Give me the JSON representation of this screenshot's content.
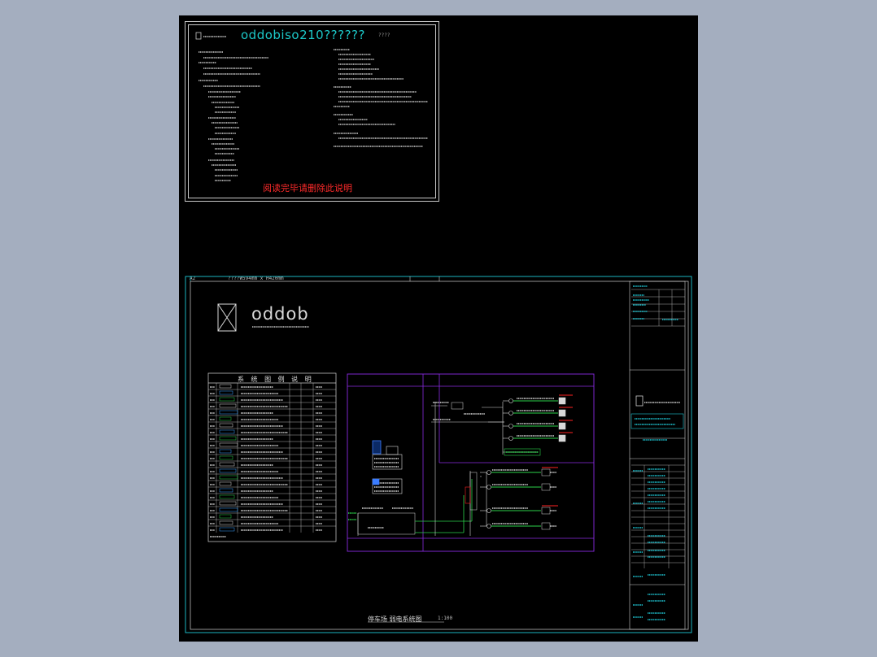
{
  "notes_panel": {
    "title": "oddobiso210??????",
    "code": "????",
    "warning": "阅读完毕请删除此说明"
  },
  "drawing": {
    "size_label": "????W594mm x H420mm",
    "sheet_tag": "A2",
    "logo_text": "oddob",
    "legend_title": "系 统 图 例 说 明",
    "diagram_caption": "停车场 弱电系统图",
    "scale": "1:100"
  },
  "colors": {
    "sheet": "#000000",
    "desktop": "#a4aebf",
    "frame_cyan": "#1fc8d6",
    "diagram_purple": "#8a2be2",
    "trunk_green": "#2bd24a",
    "alert_red": "#ff2222",
    "text_gray": "#c8c8c8"
  }
}
